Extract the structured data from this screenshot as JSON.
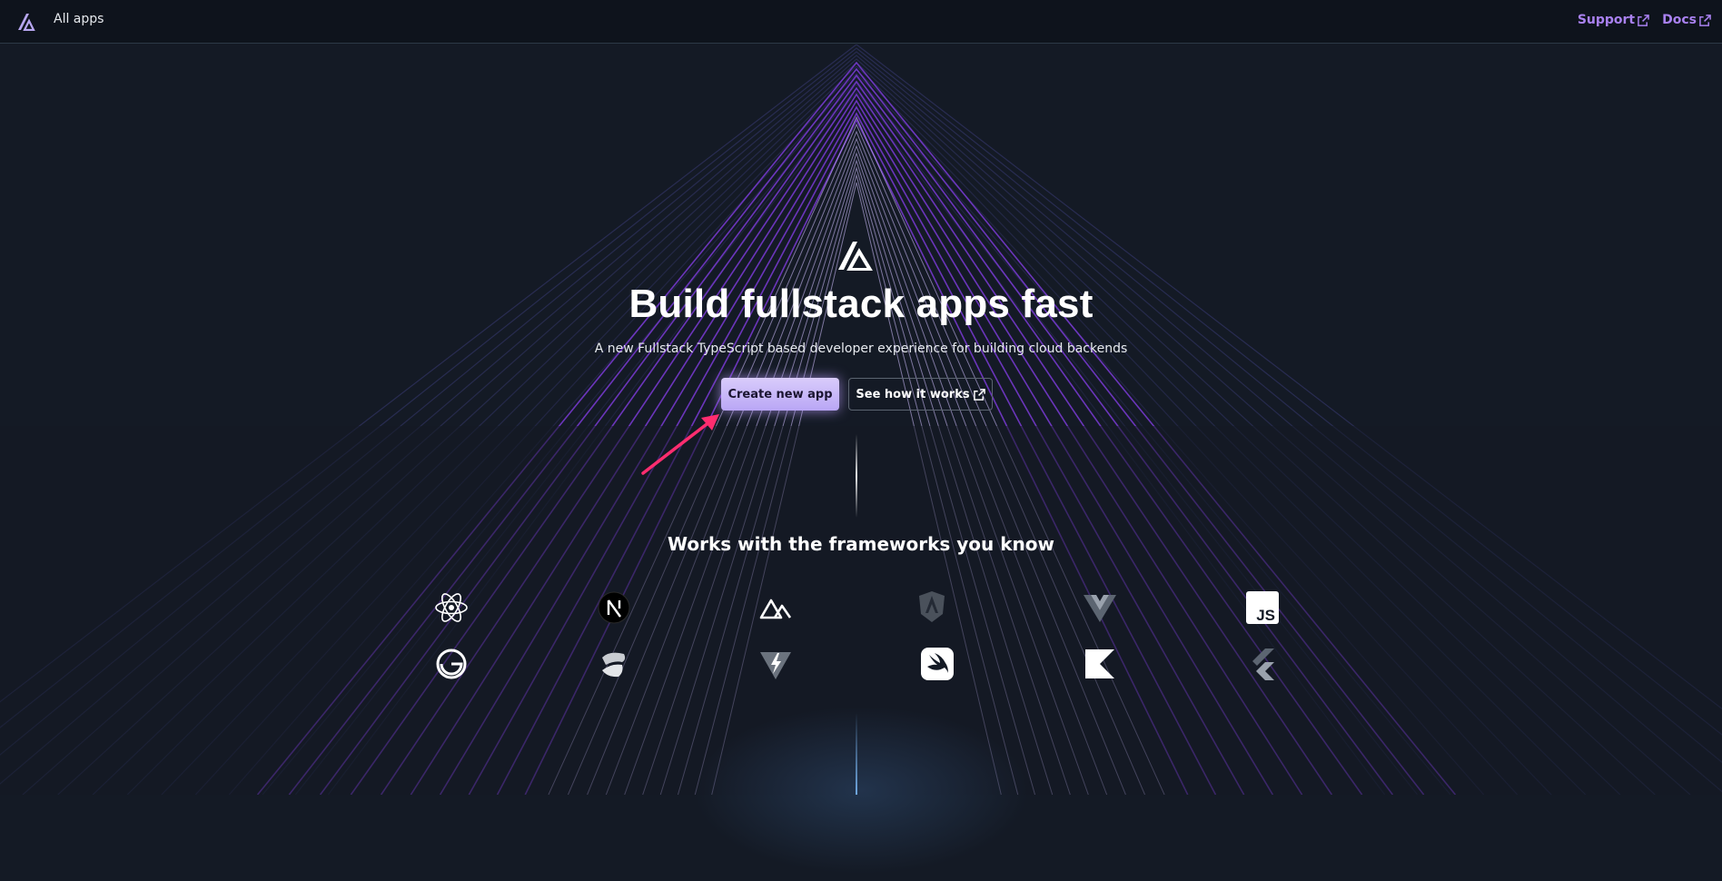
{
  "topbar": {
    "all_apps_label": "All apps",
    "links": [
      {
        "label": "Support",
        "icon": "external-link-icon"
      },
      {
        "label": "Docs",
        "icon": "external-link-icon"
      }
    ]
  },
  "hero": {
    "title": "Build fullstack apps fast",
    "subtitle": "A new Fullstack TypeScript based developer experience for building cloud backends",
    "primary_button": "Create new app",
    "secondary_button": "See how it works"
  },
  "frameworks": {
    "title": "Works with the frameworks you know",
    "icons": [
      "react-icon",
      "nextjs-icon",
      "nuxt-icon",
      "angular-icon",
      "vue-icon",
      "javascript-icon",
      "gatsby-icon",
      "ionic-icon",
      "vite-icon",
      "swift-icon",
      "kotlin-icon",
      "flutter-icon"
    ],
    "js_text": "JS"
  },
  "colors": {
    "background": "#141a25",
    "topbar": "#0e131c",
    "link_accent": "#a981f0",
    "primary_button": "#c9b8f8",
    "annotation_arrow": "#ff2d6f"
  }
}
